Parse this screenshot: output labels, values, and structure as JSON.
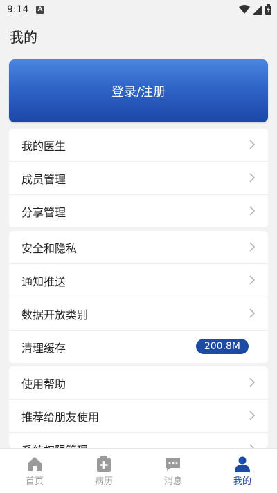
{
  "status": {
    "time": "9:14",
    "notification_letter": "A"
  },
  "page_title": "我的",
  "login_label": "登录/注册",
  "group1": [
    {
      "label": "我的医生"
    },
    {
      "label": "成员管理"
    },
    {
      "label": "分享管理"
    }
  ],
  "group2": [
    {
      "label": "安全和隐私"
    },
    {
      "label": "通知推送"
    },
    {
      "label": "数据开放类别"
    },
    {
      "label": "清理缓存",
      "badge": "200.8M"
    }
  ],
  "group3": [
    {
      "label": "使用帮助"
    },
    {
      "label": "推荐给朋友使用"
    },
    {
      "label": "系统权限管理"
    }
  ],
  "tabs": [
    {
      "label": "首页",
      "icon": "home-icon"
    },
    {
      "label": "病历",
      "icon": "medical-record-icon"
    },
    {
      "label": "消息",
      "icon": "message-icon"
    },
    {
      "label": "我的",
      "icon": "person-icon",
      "active": true
    }
  ],
  "colors": {
    "accent": "#1d4aa3",
    "banner_top": "#4a86e0",
    "banner_bottom": "#1c47a8",
    "tab_inactive": "#9a9a9a"
  }
}
